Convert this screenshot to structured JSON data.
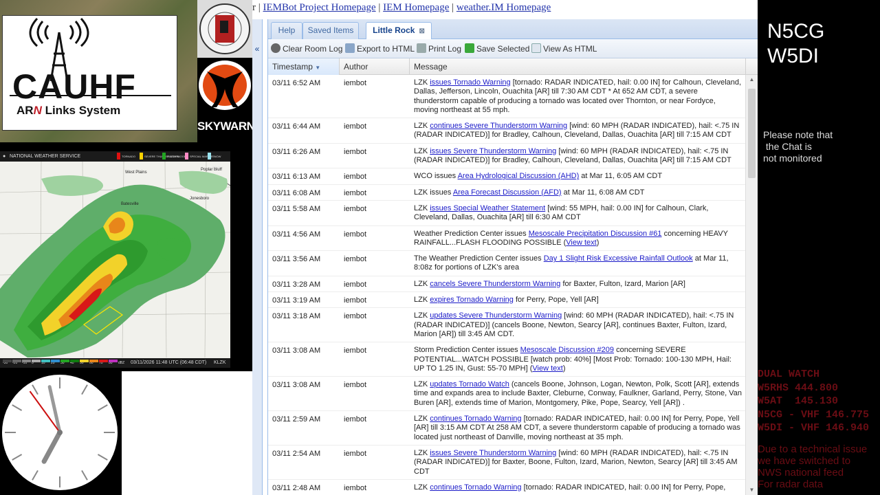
{
  "logos": {
    "cauhf": "CAUHF",
    "arn_prefix": "AR",
    "arn_n": "N",
    "arn_suffix": "Links System",
    "skywarn": "SKYWARN"
  },
  "radar": {
    "header": "NATIONAL WEATHER SERVICE",
    "legend": [
      "TORNADO",
      "SEVERE THUNDERSTORM",
      "FLASH FLOOD",
      "SPECIAL MARINE",
      "SNOW SQUALL"
    ],
    "legend_colors": [
      "#e01010",
      "#ffd200",
      "#22a422",
      "#ff8ac4",
      "#9be4f0"
    ],
    "footer_time": "03/11/2026 11:48 UTC (06:48 CDT)",
    "footer_site": "KLZK",
    "scale": [
      "-30",
      "-20",
      "-10",
      "0",
      "10",
      "20",
      "30",
      "40",
      "50",
      "60",
      "70",
      "80",
      "dBZ"
    ],
    "towns": [
      "West Plains",
      "Poplar Bluff",
      "Batesville",
      "Jonesboro"
    ]
  },
  "clock": {
    "hour": 6,
    "minute": 57,
    "second": 54
  },
  "links": {
    "prefix": "r |",
    "items": [
      "IEMBot Project Homepage",
      "IEM Homepage",
      "weather.IM Homepage"
    ]
  },
  "tabs": [
    {
      "label": "Help"
    },
    {
      "label": "Saved Items"
    },
    {
      "label": "Little Rock",
      "active": true
    }
  ],
  "toolbar": {
    "clear": "Clear Room Log",
    "export": "Export to HTML",
    "print": "Print Log",
    "save": "Save Selected",
    "view": "View As HTML"
  },
  "columns": {
    "timestamp": "Timestamp",
    "author": "Author",
    "message": "Message"
  },
  "rows": [
    {
      "ts": "03/11 6:52 AM",
      "author": "iembot",
      "pre": "LZK ",
      "link": "issues Tornado Warning",
      "post": " [tornado: RADAR INDICATED, hail: 0.00 IN] for Calhoun, Cleveland, Dallas, Jefferson, Lincoln, Ouachita [AR] till 7:30 AM CDT * At 652 AM CDT, a severe thunderstorm capable of producing a tornado was located over Thornton, or near Fordyce, moving northeast at 55 mph."
    },
    {
      "ts": "03/11 6:44 AM",
      "author": "iembot",
      "pre": "LZK ",
      "link": "continues Severe Thunderstorm Warning",
      "post": " [wind: 60 MPH (RADAR INDICATED), hail: <.75 IN (RADAR INDICATED)] for Bradley, Calhoun, Cleveland, Dallas, Ouachita [AR] till 7:15 AM CDT"
    },
    {
      "ts": "03/11 6:26 AM",
      "author": "iembot",
      "pre": "LZK ",
      "link": "issues Severe Thunderstorm Warning",
      "post": " [wind: 60 MPH (RADAR INDICATED), hail: <.75 IN (RADAR INDICATED)] for Bradley, Calhoun, Cleveland, Dallas, Ouachita [AR] till 7:15 AM CDT"
    },
    {
      "ts": "03/11 6:13 AM",
      "author": "iembot",
      "pre": "WCO issues ",
      "link": "Area Hydrological Discussion (AHD)",
      "post": " at Mar 11, 6:05 AM CDT"
    },
    {
      "ts": "03/11 6:08 AM",
      "author": "iembot",
      "pre": "LZK issues ",
      "link": "Area Forecast Discussion (AFD)",
      "post": " at Mar 11, 6:08 AM CDT"
    },
    {
      "ts": "03/11 5:58 AM",
      "author": "iembot",
      "pre": "LZK ",
      "link": "issues Special Weather Statement",
      "post": " [wind: 55 MPH, hail: 0.00 IN] for Calhoun, Clark, Cleveland, Dallas, Ouachita [AR] till 6:30 AM CDT"
    },
    {
      "ts": "03/11 4:56 AM",
      "author": "iembot",
      "pre": "Weather Prediction Center issues ",
      "link": "Mesoscale Precipitation Discussion #61",
      "post": " concerning HEAVY RAINFALL...FLASH FLOODING POSSIBLE (",
      "link2": "View text",
      "post2": ")"
    },
    {
      "ts": "03/11 3:56 AM",
      "author": "iembot",
      "pre": "The Weather Prediction Center issues ",
      "link": "Day 1 Slight Risk Excessive Rainfall Outlook",
      "post": " at Mar 11, 8:08z for portions of LZK's area"
    },
    {
      "ts": "03/11 3:28 AM",
      "author": "iembot",
      "pre": "LZK ",
      "link": "cancels Severe Thunderstorm Warning",
      "post": " for Baxter, Fulton, Izard, Marion [AR]"
    },
    {
      "ts": "03/11 3:19 AM",
      "author": "iembot",
      "pre": "LZK ",
      "link": "expires Tornado Warning",
      "post": " for Perry, Pope, Yell [AR]"
    },
    {
      "ts": "03/11 3:18 AM",
      "author": "iembot",
      "pre": "LZK ",
      "link": "updates Severe Thunderstorm Warning",
      "post": " [wind: 60 MPH (RADAR INDICATED), hail: <.75 IN (RADAR INDICATED)] (cancels Boone, Newton, Searcy [AR], continues Baxter, Fulton, Izard, Marion [AR]) till 3:45 AM CDT."
    },
    {
      "ts": "03/11 3:08 AM",
      "author": "iembot",
      "pre": "Storm Prediction Center issues ",
      "link": "Mesoscale Discussion #209",
      "post": " concerning SEVERE POTENTIAL...WATCH POSSIBLE [watch prob: 40%] [Most Prob: Tornado: 100-130 MPH, Hail: UP TO 1.25 IN, Gust: 55-70 MPH] (",
      "link2": "View text",
      "post2": ")"
    },
    {
      "ts": "03/11 3:08 AM",
      "author": "iembot",
      "pre": "LZK ",
      "link": "updates Tornado Watch",
      "post": " (cancels Boone, Johnson, Logan, Newton, Polk, Scott [AR], extends time and expands area to include Baxter, Cleburne, Conway, Faulkner, Garland, Perry, Stone, Van Buren [AR], extends time of Marion, Montgomery, Pike, Pope, Searcy, Yell [AR]) ."
    },
    {
      "ts": "03/11 2:59 AM",
      "author": "iembot",
      "pre": "LZK ",
      "link": "continues Tornado Warning",
      "post": " [tornado: RADAR INDICATED, hail: 0.00 IN] for Perry, Pope, Yell [AR] till 3:15 AM CDT At 258 AM CDT, a severe thunderstorm capable of producing a tornado was located just northeast of Danville, moving northeast at 35 mph."
    },
    {
      "ts": "03/11 2:54 AM",
      "author": "iembot",
      "pre": "LZK ",
      "link": "issues Severe Thunderstorm Warning",
      "post": " [wind: 60 MPH (RADAR INDICATED), hail: <.75 IN (RADAR INDICATED)] for Baxter, Boone, Fulton, Izard, Marion, Newton, Searcy [AR] till 3:45 AM CDT"
    },
    {
      "ts": "03/11 2:48 AM",
      "author": "iembot",
      "pre": "LZK ",
      "link": "continues Tornado Warning",
      "post": " [tornado: RADAR INDICATED, hail: 0.00 IN] for Perry, Pope,"
    }
  ],
  "right": {
    "callsign1": "N5CG",
    "callsign2": "W5DI",
    "note": "Please note that\n the Chat is\nnot monitored",
    "dual_watch": "DUAL WATCH\nW5RHS 444.800\nW5AT  145.130\nN5CG - VHF 146.775\nW5DI - VHF 146.940",
    "tech_issue": "Due to a technical issue\nwe have switched to\nNWS national feed\nFor radar data"
  }
}
